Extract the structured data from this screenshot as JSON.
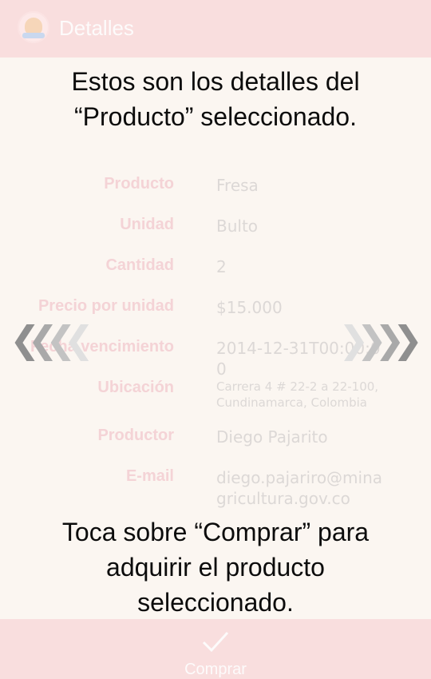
{
  "appbar": {
    "title": "Detalles",
    "icon": "app-logo-icon"
  },
  "overlay": {
    "top_line1": "Estos son los detalles del",
    "top_line2": "“Producto” seleccionado.",
    "bottom_line1": "Toca sobre “Comprar” para",
    "bottom_line2": "adquirir el producto",
    "bottom_line3": "seleccionado."
  },
  "details": [
    {
      "label": "Producto",
      "value": "Fresa"
    },
    {
      "label": "Unidad",
      "value": "Bulto"
    },
    {
      "label": "Cantidad",
      "value": "2"
    },
    {
      "label": "Precio por unidad",
      "value": "$15.000"
    },
    {
      "label": "Fecha vencimiento",
      "value": "2014-12-31T00:00:00"
    },
    {
      "label": "Ubicación",
      "value": "Carrera 4 # 22-2 a 22-100, Cundinamarca, Colombia"
    },
    {
      "label": "Productor",
      "value": "Diego Pajarito"
    },
    {
      "label": "E-mail",
      "value": "diego.pajariro@minagricultura.gov.co"
    }
  ],
  "nav": {
    "left_icon": "swipe-left-chevrons-icon",
    "right_icon": "swipe-right-chevrons-icon"
  },
  "bottombar": {
    "buy_label": "Comprar",
    "icon": "check-icon"
  },
  "colors": {
    "bar": "#f9dede",
    "background": "#fbf6f1",
    "label": "#f4d3d6",
    "value": "#dcd8d6"
  }
}
